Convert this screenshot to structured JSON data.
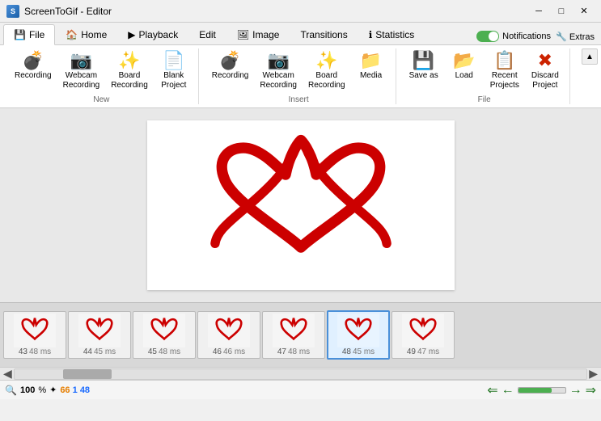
{
  "titleBar": {
    "title": "ScreenToGif - Editor",
    "appIcon": "S"
  },
  "tabs": [
    {
      "id": "file",
      "label": "File",
      "icon": "💾",
      "active": true
    },
    {
      "id": "home",
      "label": "Home",
      "icon": "🏠",
      "active": false
    },
    {
      "id": "playback",
      "label": "Playback",
      "icon": "▶",
      "active": false
    },
    {
      "id": "edit",
      "label": "Edit",
      "icon": "",
      "active": false
    },
    {
      "id": "image",
      "label": "Image",
      "icon": "🖼",
      "active": false
    },
    {
      "id": "transitions",
      "label": "Transitions",
      "icon": "",
      "active": false
    },
    {
      "id": "statistics",
      "label": "Statistics",
      "icon": "ℹ",
      "active": false
    }
  ],
  "notifications": {
    "label": "Notifications",
    "enabled": true
  },
  "extras": {
    "label": "Extras",
    "icon": "🔧"
  },
  "ribbon": {
    "groups": [
      {
        "id": "new",
        "label": "New",
        "items": [
          {
            "id": "recording",
            "label": "Recording",
            "icon": "💣"
          },
          {
            "id": "webcam-recording",
            "label": "Webcam\nRecording",
            "icon": "📷"
          },
          {
            "id": "board-recording",
            "label": "Board\nRecording",
            "icon": "✨"
          },
          {
            "id": "blank-project",
            "label": "Blank\nProject",
            "icon": "📄"
          }
        ]
      },
      {
        "id": "insert",
        "label": "Insert",
        "items": [
          {
            "id": "recording2",
            "label": "Recording",
            "icon": "💣"
          },
          {
            "id": "webcam-recording2",
            "label": "Webcam\nRecording",
            "icon": "📷"
          },
          {
            "id": "board-recording2",
            "label": "Board\nRecording",
            "icon": "✨"
          },
          {
            "id": "media",
            "label": "Media",
            "icon": "📁"
          }
        ]
      },
      {
        "id": "file",
        "label": "File",
        "items": [
          {
            "id": "save-as",
            "label": "Save as",
            "icon": "💾"
          },
          {
            "id": "load",
            "label": "Load",
            "icon": "📂"
          },
          {
            "id": "recent-projects",
            "label": "Recent\nProjects",
            "icon": "📋"
          },
          {
            "id": "discard-project",
            "label": "Discard\nProject",
            "icon": "✖"
          }
        ]
      }
    ]
  },
  "filmstrip": {
    "frames": [
      {
        "num": "43",
        "time": "48 ms",
        "selected": false
      },
      {
        "num": "44",
        "time": "45 ms",
        "selected": false
      },
      {
        "num": "45",
        "time": "48 ms",
        "selected": false
      },
      {
        "num": "46",
        "time": "46 ms",
        "selected": false
      },
      {
        "num": "47",
        "time": "48 ms",
        "selected": false
      },
      {
        "num": "48",
        "time": "45 ms",
        "selected": true
      },
      {
        "num": "49",
        "time": "47 ms",
        "selected": false
      }
    ]
  },
  "statusBar": {
    "zoom": "100",
    "zoomUnit": "%",
    "frameCount": "66",
    "selected": "1",
    "frameNum": "48",
    "progressPercent": 72
  }
}
